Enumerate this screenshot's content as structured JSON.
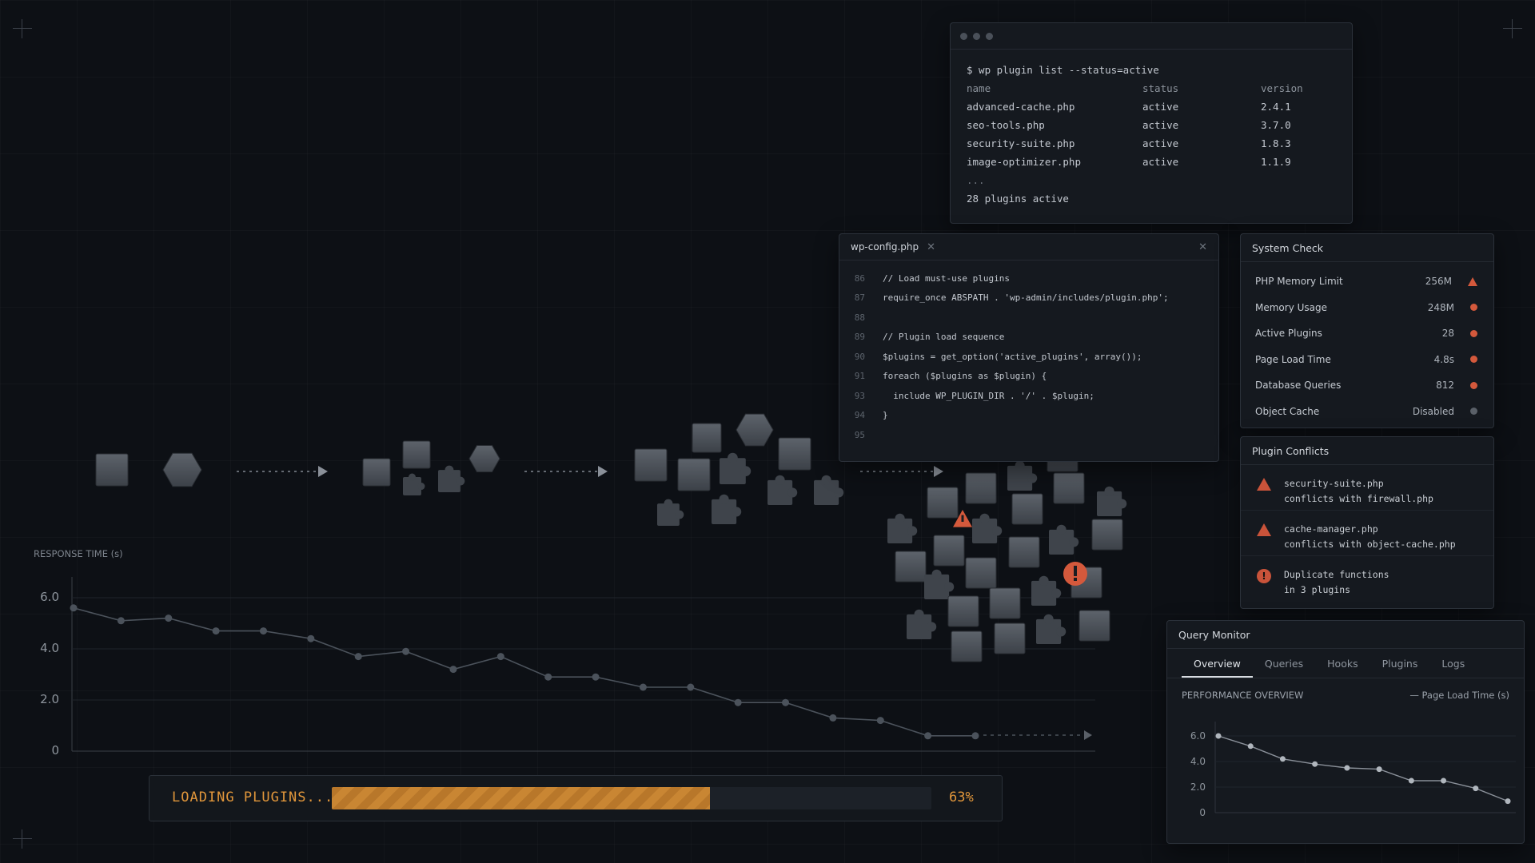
{
  "terminal": {
    "command": "$ wp plugin list --status=active",
    "columns": [
      "name",
      "status",
      "version"
    ],
    "rows": [
      [
        "advanced-cache.php",
        "active",
        "2.4.1"
      ],
      [
        "seo-tools.php",
        "active",
        "3.7.0"
      ],
      [
        "security-suite.php",
        "active",
        "1.8.3"
      ],
      [
        "image-optimizer.php",
        "active",
        "1.1.9"
      ]
    ],
    "ellipsis": "...",
    "summary": "28 plugins active"
  },
  "editor": {
    "tab_label": "wp-config.php",
    "lines": [
      {
        "num": "86",
        "text": "// Load must-use plugins",
        "comment": true
      },
      {
        "num": "87",
        "text": "require_once ABSPATH . 'wp-admin/includes/plugin.php';",
        "comment": false
      },
      {
        "num": "88",
        "text": "",
        "comment": false
      },
      {
        "num": "89",
        "text": "// Plugin load sequence",
        "comment": true
      },
      {
        "num": "90",
        "text": "$plugins = get_option('active_plugins', array());",
        "comment": false
      },
      {
        "num": "91",
        "text": "foreach ($plugins as $plugin) {",
        "comment": false
      },
      {
        "num": "93",
        "text": "  include WP_PLUGIN_DIR . '/' . $plugin;",
        "comment": false
      },
      {
        "num": "94",
        "text": "}",
        "comment": false
      },
      {
        "num": "95",
        "text": "",
        "comment": false
      }
    ]
  },
  "system_check": {
    "title": "System Check",
    "rows": [
      {
        "label": "PHP Memory Limit",
        "value": "256M",
        "status": "warning"
      },
      {
        "label": "Memory Usage",
        "value": "248M",
        "status": "error"
      },
      {
        "label": "Active Plugins",
        "value": "28",
        "status": "error"
      },
      {
        "label": "Page Load Time",
        "value": "4.8s",
        "status": "error"
      },
      {
        "label": "Database Queries",
        "value": "812",
        "status": "error"
      },
      {
        "label": "Object Cache",
        "value": "Disabled",
        "status": "neutral"
      }
    ]
  },
  "conflicts": {
    "title": "Plugin Conflicts",
    "items": [
      {
        "icon": "warning-icon",
        "line1": "security-suite.php",
        "line2": "conflicts with firewall.php"
      },
      {
        "icon": "warning-icon",
        "line1": "cache-manager.php",
        "line2": "conflicts with object-cache.php"
      },
      {
        "icon": "error-icon",
        "line1": "Duplicate functions",
        "line2": "in 3 plugins"
      }
    ]
  },
  "query_monitor": {
    "title": "Query Monitor",
    "tabs": [
      "Overview",
      "Queries",
      "Hooks",
      "Plugins",
      "Logs"
    ],
    "active_tab": "Overview",
    "section_title": "PERFORMANCE OVERVIEW",
    "legend": "— Page Load Time (s)"
  },
  "loader": {
    "label": "LOADING PLUGINS...",
    "percent_text": "63%",
    "progress": 0.63
  },
  "colors": {
    "accent_orange": "#e0963b",
    "error_red": "#d4593c",
    "neutral_grey": "#5a6068"
  },
  "chart_data": [
    {
      "type": "line",
      "title": "",
      "ylabel": "RESPONSE TIME (s)",
      "xlabel": "",
      "ylim": [
        0,
        6.5
      ],
      "yticks": [
        "6.0",
        "4.0",
        "2.0",
        "0"
      ],
      "x": [
        0,
        1,
        2,
        3,
        4,
        5,
        6,
        7,
        8,
        9,
        10,
        11,
        12,
        13,
        14,
        15,
        16,
        17,
        18,
        19
      ],
      "series": [
        {
          "values": [
            5.6,
            5.1,
            5.2,
            4.7,
            4.7,
            4.4,
            3.7,
            3.9,
            3.2,
            3.7,
            2.9,
            2.9,
            2.5,
            2.5,
            1.9,
            1.9,
            1.3,
            1.2,
            0.6,
            0.6
          ]
        }
      ]
    },
    {
      "type": "line",
      "title": "PERFORMANCE OVERVIEW",
      "ylim": [
        0,
        6.5
      ],
      "yticks": [
        "6.0",
        "4.0",
        "2.0",
        "0"
      ],
      "x": [
        0,
        1,
        2,
        3,
        4,
        5,
        6,
        7,
        8,
        9
      ],
      "series": [
        {
          "name": "Page Load Time (s)",
          "values": [
            6.0,
            5.2,
            4.2,
            3.8,
            3.5,
            3.4,
            2.5,
            2.5,
            1.9,
            0.9
          ]
        }
      ]
    }
  ]
}
